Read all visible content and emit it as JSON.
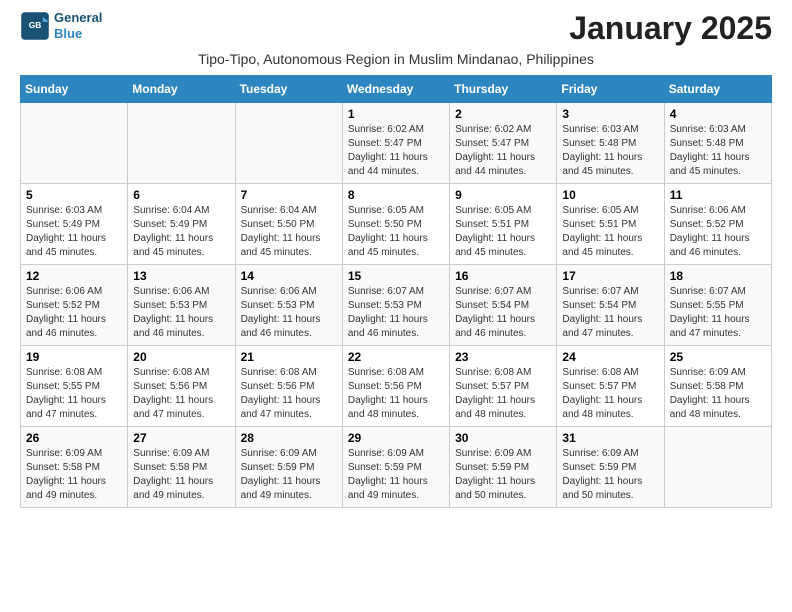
{
  "logo": {
    "line1": "General",
    "line2": "Blue"
  },
  "title": "January 2025",
  "subtitle": "Tipo-Tipo, Autonomous Region in Muslim Mindanao, Philippines",
  "days_of_week": [
    "Sunday",
    "Monday",
    "Tuesday",
    "Wednesday",
    "Thursday",
    "Friday",
    "Saturday"
  ],
  "weeks": [
    [
      {
        "day": "",
        "info": ""
      },
      {
        "day": "",
        "info": ""
      },
      {
        "day": "",
        "info": ""
      },
      {
        "day": "1",
        "info": "Sunrise: 6:02 AM\nSunset: 5:47 PM\nDaylight: 11 hours and 44 minutes."
      },
      {
        "day": "2",
        "info": "Sunrise: 6:02 AM\nSunset: 5:47 PM\nDaylight: 11 hours and 44 minutes."
      },
      {
        "day": "3",
        "info": "Sunrise: 6:03 AM\nSunset: 5:48 PM\nDaylight: 11 hours and 45 minutes."
      },
      {
        "day": "4",
        "info": "Sunrise: 6:03 AM\nSunset: 5:48 PM\nDaylight: 11 hours and 45 minutes."
      }
    ],
    [
      {
        "day": "5",
        "info": "Sunrise: 6:03 AM\nSunset: 5:49 PM\nDaylight: 11 hours and 45 minutes."
      },
      {
        "day": "6",
        "info": "Sunrise: 6:04 AM\nSunset: 5:49 PM\nDaylight: 11 hours and 45 minutes."
      },
      {
        "day": "7",
        "info": "Sunrise: 6:04 AM\nSunset: 5:50 PM\nDaylight: 11 hours and 45 minutes."
      },
      {
        "day": "8",
        "info": "Sunrise: 6:05 AM\nSunset: 5:50 PM\nDaylight: 11 hours and 45 minutes."
      },
      {
        "day": "9",
        "info": "Sunrise: 6:05 AM\nSunset: 5:51 PM\nDaylight: 11 hours and 45 minutes."
      },
      {
        "day": "10",
        "info": "Sunrise: 6:05 AM\nSunset: 5:51 PM\nDaylight: 11 hours and 45 minutes."
      },
      {
        "day": "11",
        "info": "Sunrise: 6:06 AM\nSunset: 5:52 PM\nDaylight: 11 hours and 46 minutes."
      }
    ],
    [
      {
        "day": "12",
        "info": "Sunrise: 6:06 AM\nSunset: 5:52 PM\nDaylight: 11 hours and 46 minutes."
      },
      {
        "day": "13",
        "info": "Sunrise: 6:06 AM\nSunset: 5:53 PM\nDaylight: 11 hours and 46 minutes."
      },
      {
        "day": "14",
        "info": "Sunrise: 6:06 AM\nSunset: 5:53 PM\nDaylight: 11 hours and 46 minutes."
      },
      {
        "day": "15",
        "info": "Sunrise: 6:07 AM\nSunset: 5:53 PM\nDaylight: 11 hours and 46 minutes."
      },
      {
        "day": "16",
        "info": "Sunrise: 6:07 AM\nSunset: 5:54 PM\nDaylight: 11 hours and 46 minutes."
      },
      {
        "day": "17",
        "info": "Sunrise: 6:07 AM\nSunset: 5:54 PM\nDaylight: 11 hours and 47 minutes."
      },
      {
        "day": "18",
        "info": "Sunrise: 6:07 AM\nSunset: 5:55 PM\nDaylight: 11 hours and 47 minutes."
      }
    ],
    [
      {
        "day": "19",
        "info": "Sunrise: 6:08 AM\nSunset: 5:55 PM\nDaylight: 11 hours and 47 minutes."
      },
      {
        "day": "20",
        "info": "Sunrise: 6:08 AM\nSunset: 5:56 PM\nDaylight: 11 hours and 47 minutes."
      },
      {
        "day": "21",
        "info": "Sunrise: 6:08 AM\nSunset: 5:56 PM\nDaylight: 11 hours and 47 minutes."
      },
      {
        "day": "22",
        "info": "Sunrise: 6:08 AM\nSunset: 5:56 PM\nDaylight: 11 hours and 48 minutes."
      },
      {
        "day": "23",
        "info": "Sunrise: 6:08 AM\nSunset: 5:57 PM\nDaylight: 11 hours and 48 minutes."
      },
      {
        "day": "24",
        "info": "Sunrise: 6:08 AM\nSunset: 5:57 PM\nDaylight: 11 hours and 48 minutes."
      },
      {
        "day": "25",
        "info": "Sunrise: 6:09 AM\nSunset: 5:58 PM\nDaylight: 11 hours and 48 minutes."
      }
    ],
    [
      {
        "day": "26",
        "info": "Sunrise: 6:09 AM\nSunset: 5:58 PM\nDaylight: 11 hours and 49 minutes."
      },
      {
        "day": "27",
        "info": "Sunrise: 6:09 AM\nSunset: 5:58 PM\nDaylight: 11 hours and 49 minutes."
      },
      {
        "day": "28",
        "info": "Sunrise: 6:09 AM\nSunset: 5:59 PM\nDaylight: 11 hours and 49 minutes."
      },
      {
        "day": "29",
        "info": "Sunrise: 6:09 AM\nSunset: 5:59 PM\nDaylight: 11 hours and 49 minutes."
      },
      {
        "day": "30",
        "info": "Sunrise: 6:09 AM\nSunset: 5:59 PM\nDaylight: 11 hours and 50 minutes."
      },
      {
        "day": "31",
        "info": "Sunrise: 6:09 AM\nSunset: 5:59 PM\nDaylight: 11 hours and 50 minutes."
      },
      {
        "day": "",
        "info": ""
      }
    ]
  ]
}
